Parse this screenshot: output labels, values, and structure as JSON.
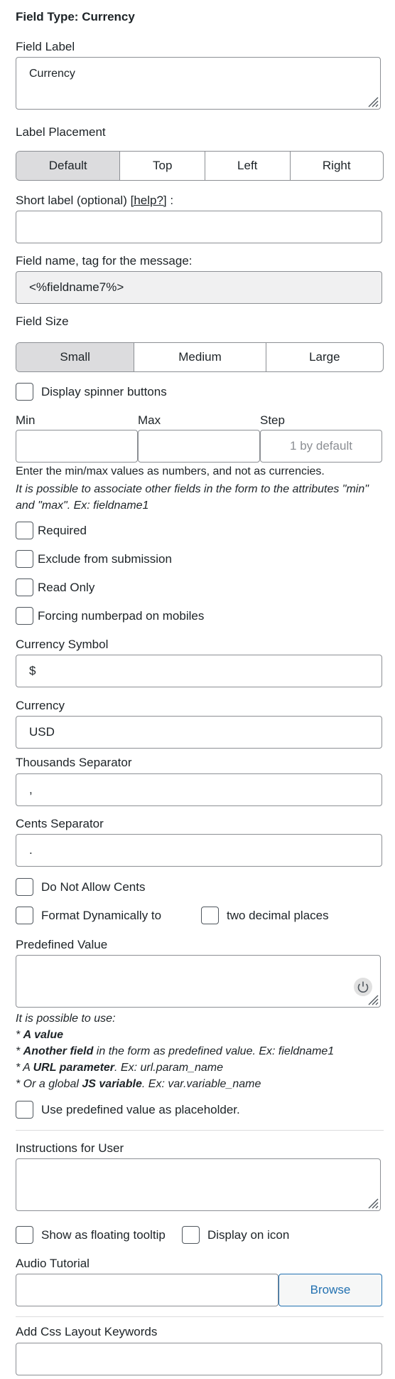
{
  "header": {
    "title": "Field Type: Currency"
  },
  "field_label": {
    "label": "Field Label",
    "value": "Currency"
  },
  "label_placement": {
    "label": "Label Placement",
    "options": [
      "Default",
      "Top",
      "Left",
      "Right"
    ],
    "selected": "Default"
  },
  "short_label": {
    "label_prefix": "Short label (optional) ",
    "help": "[help?]",
    "label_suffix": " :",
    "value": ""
  },
  "field_name": {
    "label": "Field name, tag for the message:",
    "value": "<%fieldname7%>"
  },
  "field_size": {
    "label": "Field Size",
    "options": [
      "Small",
      "Medium",
      "Large"
    ],
    "selected": "Small"
  },
  "spinner": {
    "label": "Display spinner buttons",
    "checked": false
  },
  "range": {
    "min_label": "Min",
    "max_label": "Max",
    "step_label": "Step",
    "min_value": "",
    "max_value": "",
    "step_placeholder": "1 by default",
    "note1": "Enter the min/max values as numbers, and not as currencies.",
    "note2": "It is possible to associate other fields in the form to the attributes \"min\" and \"max\". Ex: fieldname1"
  },
  "checks": {
    "required": "Required",
    "exclude": "Exclude from submission",
    "readonly": "Read Only",
    "numberpad": "Forcing numberpad on mobiles"
  },
  "currency_symbol": {
    "label": "Currency Symbol",
    "value": "$"
  },
  "currency": {
    "label": "Currency",
    "value": "USD"
  },
  "thousands": {
    "label": "Thousands Separator",
    "value": ","
  },
  "cents": {
    "label": "Cents Separator",
    "value": "."
  },
  "no_cents": {
    "label": "Do Not Allow Cents"
  },
  "format_dynamic": {
    "label": "Format Dynamically to",
    "decimals_label": "two decimal places"
  },
  "predefined": {
    "label": "Predefined Value",
    "value": "",
    "help_intro": "It is possible to use:",
    "help_a_bold": "A value",
    "help_b_bold": "Another field",
    "help_b_rest": " in the form as predefined value. Ex: fieldname1",
    "help_c_pre": "A ",
    "help_c_bold": "URL parameter",
    "help_c_rest": ". Ex: url.param_name",
    "help_d_pre": "Or a global ",
    "help_d_bold": "JS variable",
    "help_d_rest": ". Ex: var.variable_name",
    "bullet": "* "
  },
  "placeholder_check": {
    "label": "Use predefined value as placeholder."
  },
  "instructions": {
    "label": "Instructions for User",
    "value": ""
  },
  "tooltip": {
    "floating_label": "Show as floating tooltip",
    "icon_label": "Display on icon"
  },
  "audio": {
    "label": "Audio Tutorial",
    "value": "",
    "browse": "Browse"
  },
  "css_keywords": {
    "label": "Add Css Layout Keywords",
    "value": ""
  },
  "colors": {
    "accent": "#2271b1",
    "border": "#8c8f94",
    "active_segment": "#dcdcde",
    "readonly_bg": "#f0f0f1"
  },
  "icons": {
    "resize": "resize-handle-icon",
    "power": "power-icon"
  }
}
